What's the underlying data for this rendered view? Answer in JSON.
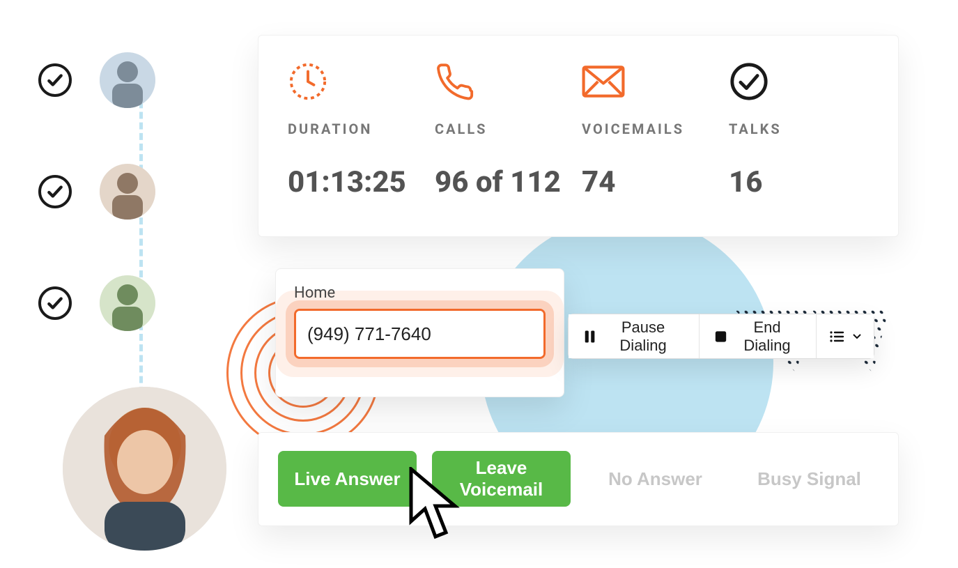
{
  "contacts": [
    {
      "checked": true
    },
    {
      "checked": true
    },
    {
      "checked": true
    }
  ],
  "stats": {
    "duration": {
      "label": "DURATION",
      "value": "01:13:25"
    },
    "calls": {
      "label": "CALLS",
      "value": "96 of 112"
    },
    "voicemails": {
      "label": "VOICEMAILS",
      "value": "74"
    },
    "talks": {
      "label": "TALKS",
      "value": "16"
    }
  },
  "dialer": {
    "label": "Home",
    "phone": "(949) 771-7640"
  },
  "controls": {
    "pause": "Pause Dialing",
    "end": "End Dialing"
  },
  "actions": {
    "live": "Live Answer",
    "vm": "Leave Voicemail",
    "noans": "No Answer",
    "busy": "Busy Signal"
  }
}
